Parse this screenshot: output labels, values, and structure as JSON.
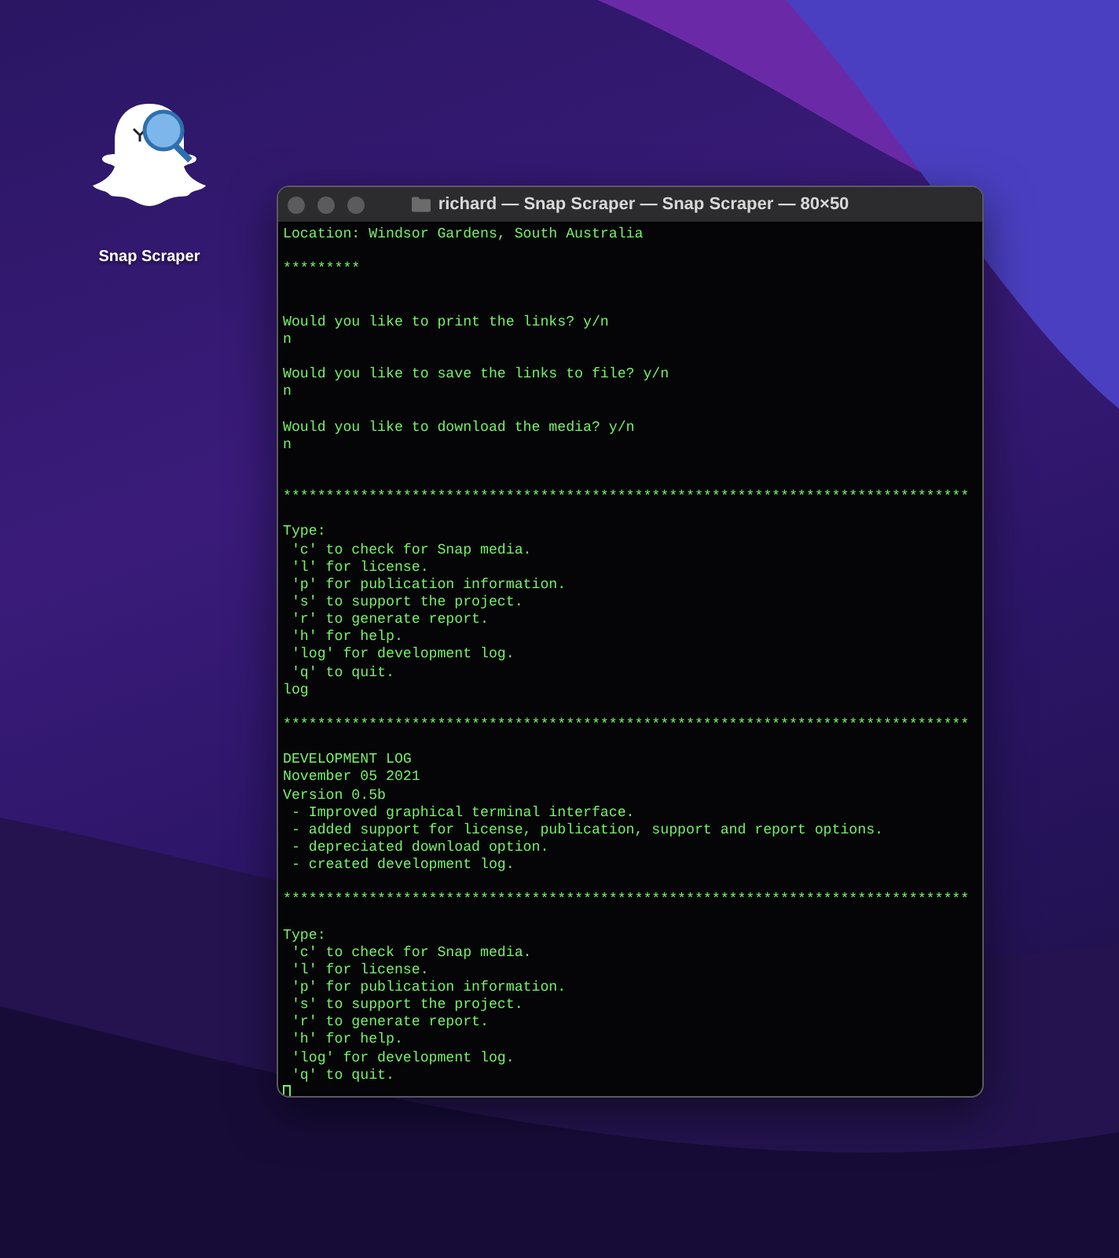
{
  "desktop_icons": [
    {
      "label": "Snap Scraper"
    }
  ],
  "window": {
    "title": "richard — Snap Scraper — Snap Scraper — 80×50",
    "lines": [
      {
        "kind": "text",
        "text": "Location: Windsor Gardens, South Australia"
      },
      {
        "kind": "blank"
      },
      {
        "kind": "text",
        "text": "*********"
      },
      {
        "kind": "blank"
      },
      {
        "kind": "blank"
      },
      {
        "kind": "text",
        "text": "Would you like to print the links? y/n"
      },
      {
        "kind": "text",
        "text": "n"
      },
      {
        "kind": "blank"
      },
      {
        "kind": "text",
        "text": "Would you like to save the links to file? y/n"
      },
      {
        "kind": "text",
        "text": "n"
      },
      {
        "kind": "blank"
      },
      {
        "kind": "text",
        "text": "Would you like to download the media? y/n"
      },
      {
        "kind": "text",
        "text": "n"
      },
      {
        "kind": "blank"
      },
      {
        "kind": "blank"
      },
      {
        "kind": "text",
        "text": "********************************************************************************"
      },
      {
        "kind": "blank"
      },
      {
        "kind": "text",
        "text": "Type:"
      },
      {
        "kind": "text",
        "text": " 'c' to check for Snap media."
      },
      {
        "kind": "text",
        "text": " 'l' for license."
      },
      {
        "kind": "text",
        "text": " 'p' for publication information."
      },
      {
        "kind": "text",
        "text": " 's' to support the project."
      },
      {
        "kind": "text",
        "text": " 'r' to generate report."
      },
      {
        "kind": "text",
        "text": " 'h' for help."
      },
      {
        "kind": "text",
        "text": " 'log' for development log."
      },
      {
        "kind": "text",
        "text": " 'q' to quit."
      },
      {
        "kind": "text",
        "text": "log"
      },
      {
        "kind": "blank"
      },
      {
        "kind": "text",
        "text": "********************************************************************************"
      },
      {
        "kind": "blank"
      },
      {
        "kind": "text",
        "text": "DEVELOPMENT LOG"
      },
      {
        "kind": "text",
        "text": "November 05 2021"
      },
      {
        "kind": "text",
        "text": "Version 0.5b"
      },
      {
        "kind": "text",
        "text": " - Improved graphical terminal interface."
      },
      {
        "kind": "text",
        "text": " - added support for license, publication, support and report options."
      },
      {
        "kind": "text",
        "text": " - depreciated download option."
      },
      {
        "kind": "text",
        "text": " - created development log."
      },
      {
        "kind": "blank"
      },
      {
        "kind": "text",
        "text": "********************************************************************************"
      },
      {
        "kind": "blank"
      },
      {
        "kind": "text",
        "text": "Type:"
      },
      {
        "kind": "text",
        "text": " 'c' to check for Snap media."
      },
      {
        "kind": "text",
        "text": " 'l' for license."
      },
      {
        "kind": "text",
        "text": " 'p' for publication information."
      },
      {
        "kind": "text",
        "text": " 's' to support the project."
      },
      {
        "kind": "text",
        "text": " 'r' to generate report."
      },
      {
        "kind": "text",
        "text": " 'h' for help."
      },
      {
        "kind": "text",
        "text": " 'log' for development log."
      },
      {
        "kind": "text",
        "text": " 'q' to quit."
      },
      {
        "kind": "cursor"
      }
    ]
  }
}
